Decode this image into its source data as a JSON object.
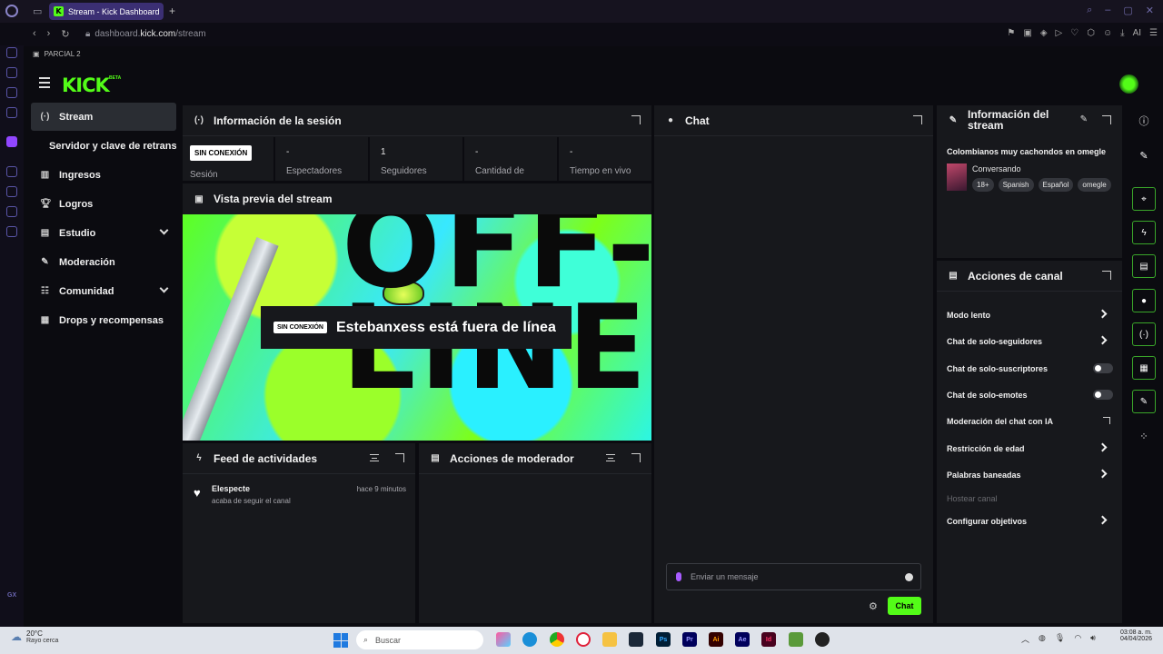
{
  "browser": {
    "tab_title": "Stream - Kick Dashboard",
    "url_prefix": "dashboard.",
    "url_domain": "kick.com",
    "url_path": "/stream",
    "bookmark": "PARCIAL 2",
    "ai_label": "AI"
  },
  "brand": {
    "logo": "KICK",
    "beta": "BETA",
    "accent": "#53fc18"
  },
  "nav": {
    "items": [
      {
        "label": "Stream",
        "icon": "broadcast-icon"
      },
      {
        "label": "Servidor y clave de retransmisión",
        "icon": ""
      },
      {
        "label": "Ingresos",
        "icon": "chart-icon"
      },
      {
        "label": "Logros",
        "icon": "trophy-icon"
      },
      {
        "label": "Estudio",
        "icon": "studio-icon"
      },
      {
        "label": "Moderación",
        "icon": "wrench-icon"
      },
      {
        "label": "Comunidad",
        "icon": "community-icon"
      },
      {
        "label": "Drops y recompensas",
        "icon": "drops-icon"
      }
    ]
  },
  "session": {
    "title": "Información de la sesión",
    "offline_badge": "SIN CONEXIÓN",
    "stats": [
      {
        "value": "",
        "label": "Sesión"
      },
      {
        "value": "-",
        "label": "Espectadores"
      },
      {
        "value": "1",
        "label": "Seguidores"
      },
      {
        "value": "-",
        "label": "Cantidad de"
      },
      {
        "value": "-",
        "label": "Tiempo en vivo"
      }
    ]
  },
  "preview": {
    "title": "Vista previa del stream",
    "art_text": "OFF-\nLINE",
    "offline_badge": "SIN CONEXIÓN",
    "offline_message": "Estebanxess está fuera de línea"
  },
  "activity": {
    "title": "Feed de actividades",
    "items": [
      {
        "user": "Elespecte",
        "desc": "acaba de seguir el canal",
        "time": "hace 9 minutos"
      }
    ]
  },
  "mod_actions": {
    "title": "Acciones de moderador"
  },
  "chat": {
    "title": "Chat",
    "placeholder": "Enviar un mensaje",
    "send_label": "Chat"
  },
  "stream_info": {
    "title": "Información del stream",
    "stream_title": "Colombianos muy cachondos en omegle",
    "category": "Conversando",
    "tags": [
      "18+",
      "Spanish",
      "Español",
      "omegle"
    ]
  },
  "channel_actions": {
    "title": "Acciones de canal",
    "items": [
      {
        "label": "Modo lento",
        "control": "chevron"
      },
      {
        "label": "Chat de solo-seguidores",
        "control": "chevron"
      },
      {
        "label": "Chat de solo-suscriptores",
        "control": "toggle",
        "on": false
      },
      {
        "label": "Chat de solo-emotes",
        "control": "toggle",
        "on": false
      },
      {
        "label": "Moderación del chat con IA",
        "control": "external"
      },
      {
        "label": "Restricción de edad",
        "control": "chevron"
      },
      {
        "label": "Palabras baneadas",
        "control": "chevron"
      },
      {
        "label": "Hostear canal",
        "control": "disabled"
      },
      {
        "label": "Configurar objetivos",
        "control": "chevron"
      }
    ]
  },
  "taskbar": {
    "temp": "20°C",
    "weather": "Rayo cerca",
    "search": "Buscar",
    "time": "03:08 a. m.",
    "date": "04/04/2026",
    "gx": "GX",
    "apps": [
      "Ps",
      "Pr",
      "Ai",
      "Ae",
      "Id"
    ]
  }
}
